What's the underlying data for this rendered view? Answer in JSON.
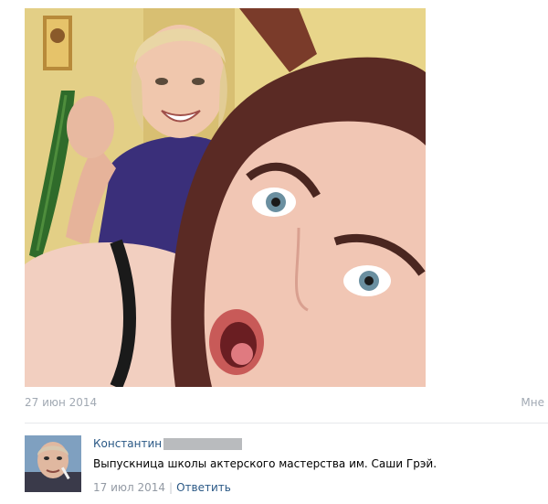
{
  "post": {
    "date": "27 июн 2014",
    "more_label": "Мне"
  },
  "comment": {
    "author": "Константин",
    "text": "Выпускница школы актерского мастерства им. Саши Грэй.",
    "date": "17 июл 2014",
    "separator": "|",
    "reply_label": "Ответить"
  },
  "colors": {
    "link": "#2a5885",
    "meta": "#a1a9b3",
    "divider": "#e7e8ec"
  }
}
